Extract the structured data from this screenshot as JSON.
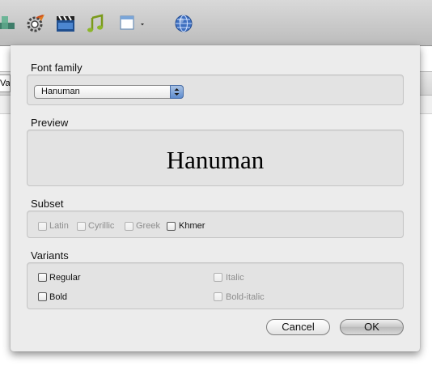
{
  "background": {
    "cell_fragment": "Va",
    "toolbar_icons": [
      "window-tile-icon",
      "gear-icon",
      "clapperboard-icon",
      "music-note-icon",
      "window-menu-icon",
      "globe-icon"
    ]
  },
  "dialog": {
    "font_family": {
      "label": "Font family",
      "selected": "Hanuman"
    },
    "preview": {
      "label": "Preview",
      "sample": "Hanuman"
    },
    "subset": {
      "label": "Subset",
      "options": [
        {
          "label": "Latin",
          "enabled": false,
          "checked": false
        },
        {
          "label": "Cyrillic",
          "enabled": false,
          "checked": false
        },
        {
          "label": "Greek",
          "enabled": false,
          "checked": false
        },
        {
          "label": "Khmer",
          "enabled": true,
          "checked": false
        }
      ]
    },
    "variants": {
      "label": "Variants",
      "options": [
        {
          "label": "Regular",
          "enabled": true,
          "checked": false
        },
        {
          "label": "Italic",
          "enabled": false,
          "checked": false
        },
        {
          "label": "Bold",
          "enabled": true,
          "checked": false
        },
        {
          "label": "Bold-italic",
          "enabled": false,
          "checked": false
        }
      ]
    },
    "buttons": {
      "cancel": "Cancel",
      "ok": "OK"
    }
  }
}
